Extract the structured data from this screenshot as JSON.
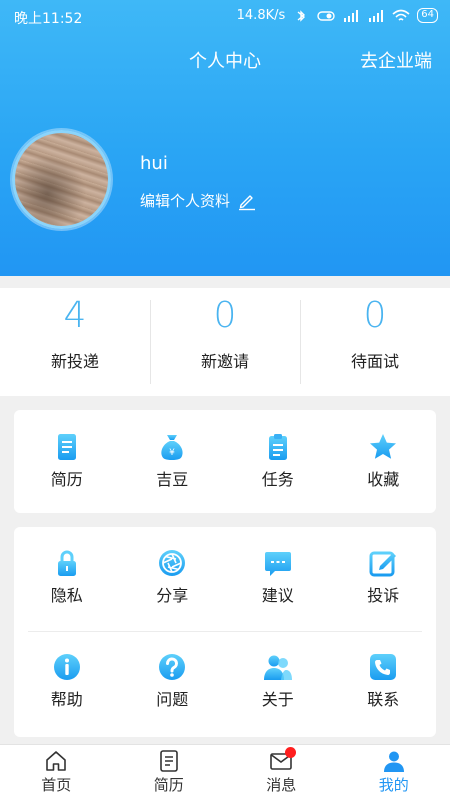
{
  "status_bar": {
    "time": "晚上11:52",
    "network_speed": "14.8K/s",
    "battery": "64"
  },
  "header": {
    "title": "个人中心",
    "enterprise_link": "去企业端",
    "username": "hui",
    "edit_profile": "编辑个人资料"
  },
  "stats": [
    {
      "value": "4",
      "label": "新投递"
    },
    {
      "value": "0",
      "label": "新邀请"
    },
    {
      "value": "0",
      "label": "待面试"
    }
  ],
  "menu_primary": [
    {
      "label": "简历",
      "icon": "resume-icon"
    },
    {
      "label": "吉豆",
      "icon": "money-bag-icon"
    },
    {
      "label": "任务",
      "icon": "clipboard-icon"
    },
    {
      "label": "收藏",
      "icon": "star-icon"
    }
  ],
  "menu_secondary": [
    {
      "label": "隐私",
      "icon": "lock-icon"
    },
    {
      "label": "分享",
      "icon": "aperture-icon"
    },
    {
      "label": "建议",
      "icon": "chat-icon"
    },
    {
      "label": "投诉",
      "icon": "edit-icon"
    },
    {
      "label": "帮助",
      "icon": "info-icon"
    },
    {
      "label": "问题",
      "icon": "question-icon"
    },
    {
      "label": "关于",
      "icon": "users-icon"
    },
    {
      "label": "联系",
      "icon": "phone-icon"
    }
  ],
  "bottom_nav": [
    {
      "label": "首页",
      "icon": "home-icon"
    },
    {
      "label": "简历",
      "icon": "document-icon"
    },
    {
      "label": "消息",
      "icon": "mail-icon"
    },
    {
      "label": "我的",
      "icon": "person-icon"
    }
  ],
  "colors": {
    "accent": "#2196f3",
    "header_top": "#3fb8f7",
    "stat_number": "#4ab4f0",
    "notification_dot": "#ff1e1e"
  }
}
